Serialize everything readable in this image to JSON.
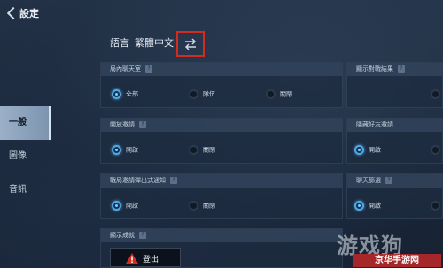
{
  "header": {
    "title": "設定"
  },
  "sidebar": {
    "items": [
      {
        "label": "一般",
        "active": true
      },
      {
        "label": "圖像",
        "active": false
      },
      {
        "label": "音訊",
        "active": false
      }
    ]
  },
  "language": {
    "label": "語言",
    "value": "繁體中文"
  },
  "panels": {
    "chat_in_game": {
      "title": "局內聊天室",
      "options": [
        "全部",
        "隊伍",
        "關閉"
      ],
      "selected": "全部"
    },
    "show_results": {
      "title": "顯示對戰結果"
    },
    "open_invite": {
      "title": "開放邀請",
      "options": [
        "開啟",
        "關閉"
      ],
      "selected": "開啟"
    },
    "hide_friend_invite": {
      "title": "隱藏好友邀請",
      "options": [
        "開啟"
      ],
      "selected": "開啟"
    },
    "battle_invite_popup": {
      "title": "戰局邀請彈出式通知",
      "options": [
        "開啟",
        "關閉"
      ],
      "selected": "開啟"
    },
    "chat_filter": {
      "title": "聊天篩選",
      "options": [
        "開啟"
      ],
      "selected": "開啟"
    },
    "show_achievements": {
      "title": "顯示成就"
    }
  },
  "help_mark": "?",
  "logout": {
    "label": "登出"
  },
  "watermark": {
    "brand": "游戏狗",
    "slogan": "京华手游网"
  },
  "colors": {
    "accent": "#4da8e6",
    "highlight_box": "#d42a1f",
    "sidebar_active": "#9bb0c8"
  },
  "icons": {
    "back": "chevron-left-icon",
    "swap": "swap-arrows-icon",
    "warning": "warning-triangle-icon"
  }
}
